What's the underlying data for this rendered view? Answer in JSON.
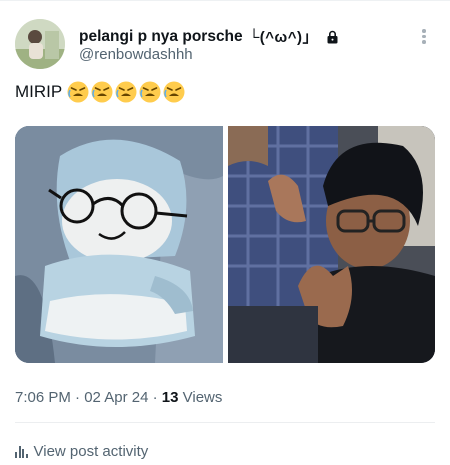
{
  "user": {
    "display_name": "pelangi p nya porsche",
    "kaomoji": "└(^ω^)」",
    "handle": "@renbowdashhh"
  },
  "post": {
    "text": "MIRIP",
    "emoji_count": 5
  },
  "meta": {
    "time": "7:06 PM",
    "sep1": " · ",
    "date": "02 Apr 24",
    "sep2": " · ",
    "views_count": "13",
    "views_label": " Views"
  },
  "activity": {
    "label": "View post activity"
  },
  "colors": {
    "text": "#0f1419",
    "secondary": "#536471",
    "emoji": "#ffcc4d"
  }
}
